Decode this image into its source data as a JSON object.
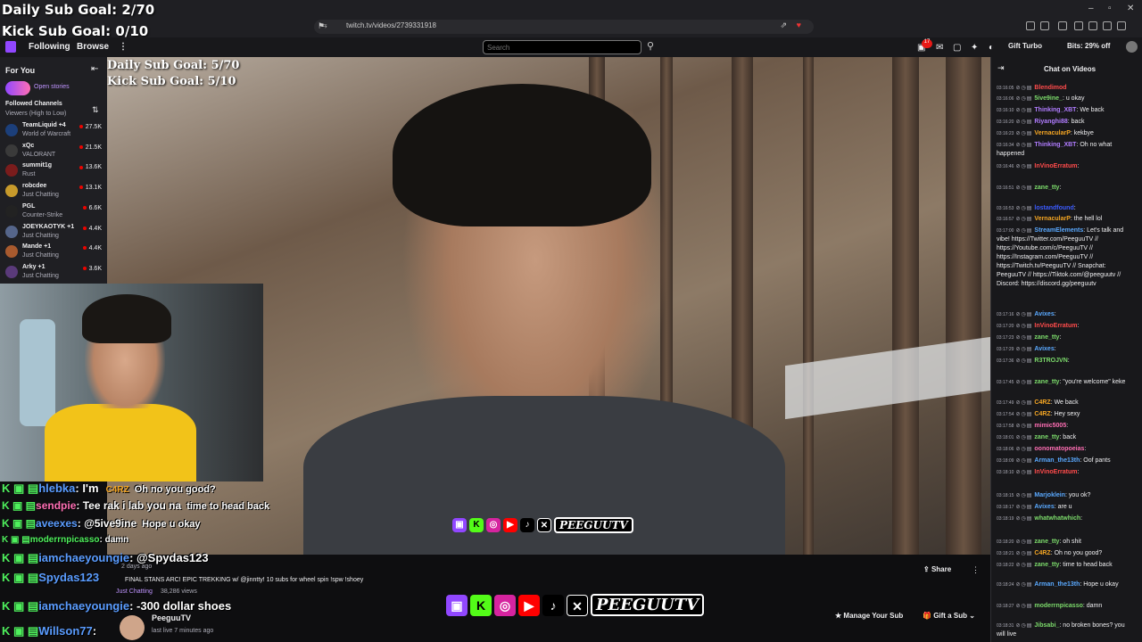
{
  "overlay_goals": {
    "daily": "Daily Sub Goal: 2/70",
    "kick": "Kick Sub Goal: 0/10"
  },
  "browser": {
    "url": "twitch.tv/videos/2739331918"
  },
  "nav": {
    "following": "Following",
    "browse": "Browse",
    "more": "⋮",
    "search_placeholder": "Search",
    "notifications": "17",
    "gift_turbo": "Gift Turbo",
    "bits": "Bits: 29% off"
  },
  "sidebar": {
    "for_you": "For You",
    "open_stories": "Open stories",
    "followed_channels": "Followed Channels",
    "sort": "Viewers (High to Low)",
    "channels": [
      {
        "name": "TeamLiquid +4",
        "game": "World of Warcraft",
        "viewers": "27.5K",
        "color": "#1c3f7a"
      },
      {
        "name": "xQc",
        "game": "VALORANT",
        "viewers": "21.5K",
        "color": "#3a3a3a"
      },
      {
        "name": "summit1g",
        "game": "Rust",
        "viewers": "13.6K",
        "color": "#7a1c1c"
      },
      {
        "name": "robcdee",
        "game": "Just Chatting",
        "viewers": "13.1K",
        "color": "#c79a2b"
      },
      {
        "name": "PGL",
        "game": "Counter-Strike",
        "viewers": "6.6K",
        "color": "#222"
      },
      {
        "name": "JOEYKAOTYK +1",
        "game": "Just Chatting",
        "viewers": "4.4K",
        "color": "#55658a"
      },
      {
        "name": "Mande +1",
        "game": "Just Chatting",
        "viewers": "4.4K",
        "color": "#a85a2e"
      },
      {
        "name": "Arky +1",
        "game": "Just Chatting",
        "viewers": "3.6K",
        "color": "#5a3a7a"
      }
    ]
  },
  "video_overlay": {
    "daily": "Daily Sub Goal: 5/70",
    "kick": "Kick Sub Goal: 5/10",
    "brand": "PEEGUUTV"
  },
  "overlay_chat": [
    {
      "user": "hlebka",
      "msg": ": I'm",
      "reply_user": "C4RZ",
      "reply": "Oh no you good?",
      "color": "#5a9cff"
    },
    {
      "user": "sendpie",
      "msg": ": Tee rak i lab you na",
      "reply": "time to head back",
      "color": "#ff6eb4"
    },
    {
      "user": "aveexes",
      "msg": ": @5ive9ine",
      "reply": "Hope u okay",
      "color": "#5a9cff"
    },
    {
      "user": "moderrnpicasso",
      "msg": ": damn",
      "color": "#4ef05c"
    },
    {
      "user": "iamchaeyoungie",
      "msg": ": @Spydas123",
      "color": "#5a9cff"
    },
    {
      "user": "Spydas123",
      "msg": "",
      "color": "#5a9cff"
    },
    {
      "user": "iamchaeyoungie",
      "msg": ": -300 dollar shoes",
      "color": "#5a9cff"
    },
    {
      "user": "Willson77",
      "msg": ":",
      "color": "#5a9cff"
    }
  ],
  "video_info": {
    "ago": "2 days ago",
    "title": "FINAL STANS ARC! EPIC TREKKING w/ @jinntty! 10 subs for wheel spin !spw !shoey",
    "category": "Just Chatting",
    "views": "38,286 views",
    "channel": "PeeguuTV",
    "last_live": "last live 7 minutes ago",
    "share": "Share",
    "manage_sub": "Manage Your Sub",
    "gift_sub": "Gift a Sub"
  },
  "chat": {
    "title": "Chat on Videos",
    "messages": [
      {
        "time": "03:16:05",
        "user": "Blendimod",
        "msg": "",
        "color": "#ff4b4b"
      },
      {
        "time": "03:16:06",
        "user": "5ive9ine_",
        "msg": ": u okay",
        "color": "#7cdb6b"
      },
      {
        "time": "03:16:10",
        "user": "Thinking_XBT",
        "msg": ": We back",
        "color": "#b07cff"
      },
      {
        "time": "03:16:20",
        "user": "Riyanghi88",
        "msg": ": back",
        "color": "#b07cff"
      },
      {
        "time": "03:16:23",
        "user": "VernacularP",
        "msg": ": kekbye",
        "color": "#f5a623"
      },
      {
        "time": "03:16:34",
        "user": "Thinking_XBT",
        "msg": ": Oh no what happened",
        "color": "#b07cff"
      },
      {
        "time": "03:16:46",
        "user": "InVinoErratum",
        "msg": ":",
        "color": "#ff4b4b"
      },
      {
        "time": "03:16:51",
        "user": "zane_tty",
        "msg": ":",
        "color": "#7cdb6b"
      },
      {
        "time": "03:16:53",
        "user": "lostandfound",
        "msg": ":",
        "color": "#3b5bff"
      },
      {
        "time": "03:16:57",
        "user": "VernacularP",
        "msg": ": the hell lol",
        "color": "#f5a623"
      },
      {
        "time": "03:17:00",
        "user": "StreamElements",
        "msg": ": Let's talk and vibe! https://Twitter.com/PeeguuTV // https://Youtube.com/c/PeeguuTV // https://Instagram.com/PeeguuTV // https://Twitch.tv/PeeguuTV // Snapchat: PeeguuTV // https://Tiktok.com/@peeguutv // Discord: https://discord.gg/peeguutv",
        "color": "#5aa9ff"
      },
      {
        "time": "03:17:16",
        "user": "Avixes",
        "msg": ":",
        "color": "#5aa9ff"
      },
      {
        "time": "03:17:20",
        "user": "InVinoErratum",
        "msg": ":",
        "color": "#ff4b4b"
      },
      {
        "time": "03:17:23",
        "user": "zane_tty",
        "msg": ":",
        "color": "#7cdb6b"
      },
      {
        "time": "03:17:29",
        "user": "Avixes",
        "msg": ":",
        "color": "#5aa9ff"
      },
      {
        "time": "03:17:36",
        "user": "R3TROJVN",
        "msg": ":",
        "color": "#7cdb6b"
      },
      {
        "time": "03:17:45",
        "user": "zane_tty",
        "msg": ": \"you're welcome\" keke",
        "color": "#7cdb6b"
      },
      {
        "time": "03:17:49",
        "user": "C4RZ",
        "msg": ": We back",
        "color": "#f5a623"
      },
      {
        "time": "03:17:54",
        "user": "C4RZ",
        "msg": ": Hey sexy",
        "color": "#f5a623"
      },
      {
        "time": "03:17:58",
        "user": "mimic5005",
        "msg": ":",
        "color": "#ff6eb4"
      },
      {
        "time": "03:18:01",
        "user": "zane_tty",
        "msg": ": back",
        "color": "#7cdb6b"
      },
      {
        "time": "03:18:06",
        "user": "oonomatopoeias",
        "msg": ":",
        "color": "#ff6eb4"
      },
      {
        "time": "03:18:09",
        "user": "Arman_the13th",
        "msg": ": Oof pants",
        "color": "#5aa9ff"
      },
      {
        "time": "03:18:10",
        "user": "InVinoErratum",
        "msg": ":",
        "color": "#ff4b4b"
      },
      {
        "time": "03:18:15",
        "user": "Marjoklein",
        "msg": ": you ok?",
        "color": "#5aa9ff"
      },
      {
        "time": "03:18:17",
        "user": "Avixes",
        "msg": ": are u",
        "color": "#5aa9ff"
      },
      {
        "time": "03:18:19",
        "user": "whatwhatwhich",
        "msg": ":",
        "color": "#7cdb6b"
      },
      {
        "time": "03:18:20",
        "user": "zane_tty",
        "msg": ": oh shit",
        "color": "#7cdb6b"
      },
      {
        "time": "03:18:21",
        "user": "C4RZ",
        "msg": ": Oh no you good?",
        "color": "#f5a623"
      },
      {
        "time": "03:18:22",
        "user": "zane_tty",
        "msg": ": time to head back",
        "color": "#7cdb6b"
      },
      {
        "time": "03:18:24",
        "user": "Arman_the13th",
        "msg": ": Hope u okay",
        "color": "#5aa9ff"
      },
      {
        "time": "03:18:27",
        "user": "moderrnpicasso",
        "msg": ": damn",
        "color": "#7cdb6b"
      },
      {
        "time": "03:18:31",
        "user": "Jibsabi_",
        "msg": ": no broken bones? you will live",
        "color": "#7cdb6b"
      }
    ]
  }
}
